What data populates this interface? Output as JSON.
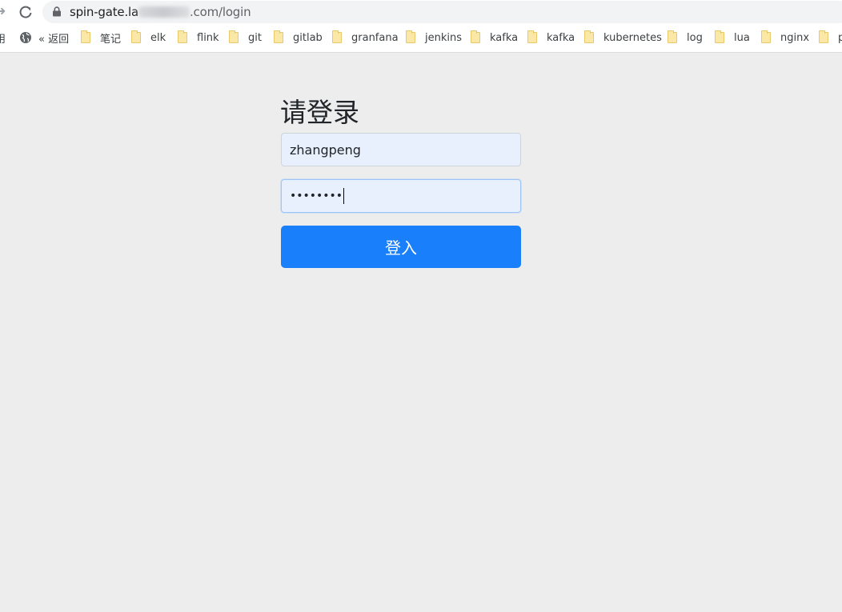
{
  "browser": {
    "url_host_prefix": "spin-gate.la",
    "url_host_suffix": ".com",
    "url_path": "/login"
  },
  "bookmarks": {
    "partial_first": "用",
    "back_label": "« 返回",
    "folders": [
      "笔记",
      "elk",
      "flink",
      "git",
      "gitlab",
      "granfana",
      "jenkins",
      "kafka",
      "kafka",
      "kubernetes",
      "log",
      "lua",
      "nginx",
      "p"
    ]
  },
  "login": {
    "title": "请登录",
    "username_value": "zhangpeng",
    "password_masked": "••••••••",
    "submit_label": "登入"
  },
  "colors": {
    "page_background": "#ededed",
    "input_background": "#e8f0fe",
    "button_primary": "#1a7ffb"
  }
}
